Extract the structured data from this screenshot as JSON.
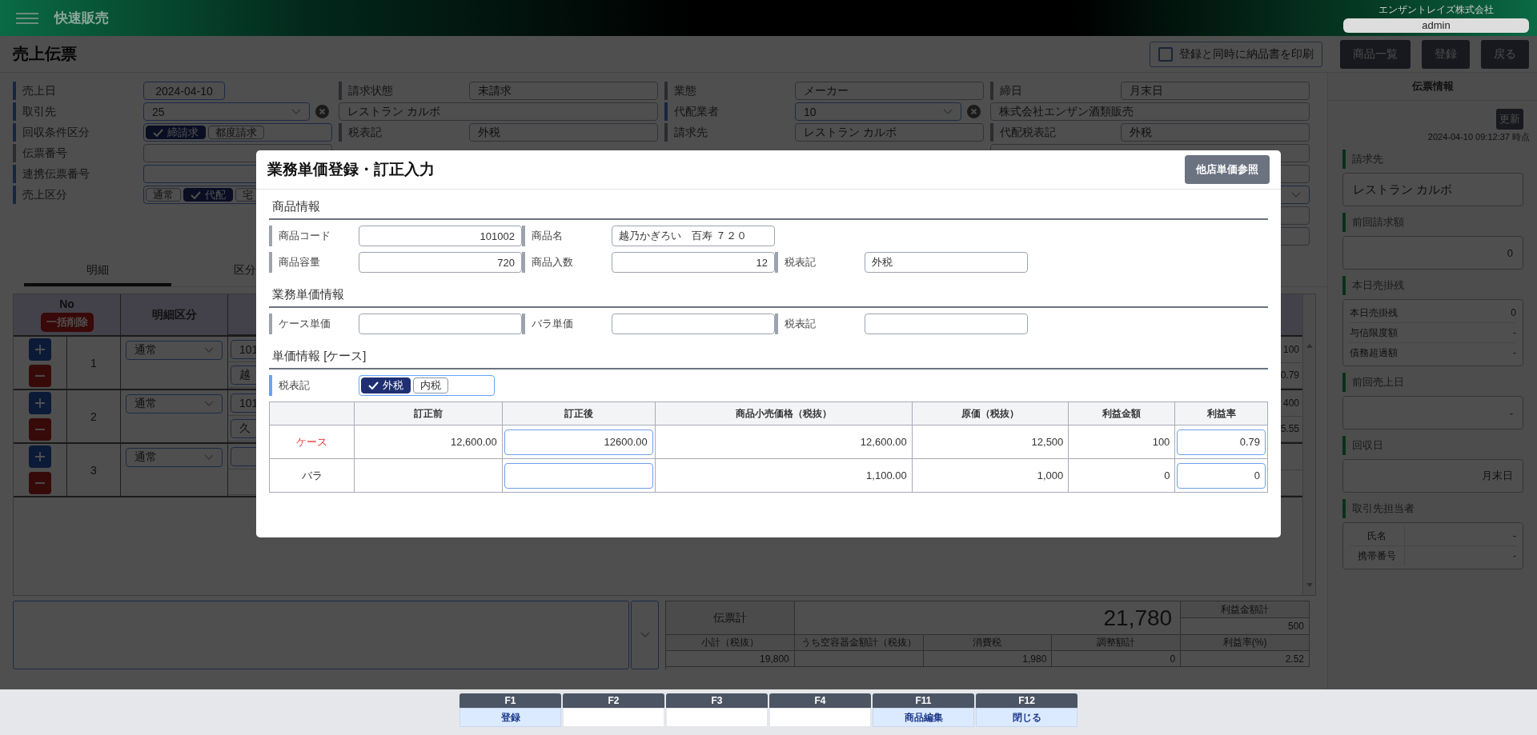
{
  "header": {
    "app_title": "快速販売",
    "company": "エンザントレイズ株式会社",
    "user": "admin"
  },
  "toolbar": {
    "title": "売上伝票",
    "print_option": {
      "label": "登録と同時に納品書を印刷",
      "checked": false
    },
    "buttons": [
      "商品一覧",
      "登録",
      "戻る"
    ]
  },
  "form": {
    "columns": [
      {
        "items": [
          {
            "label": "売上日",
            "kind": "date",
            "editable": true,
            "value": "2024-04-10"
          },
          {
            "label": "取引先",
            "kind": "select_clear",
            "editable": true,
            "value": "25"
          },
          {
            "label": "回収条件区分",
            "kind": "toggle",
            "editable": true,
            "options": [
              {
                "label": "締請求",
                "selected": true
              },
              {
                "label": "都度請求",
                "selected": false
              }
            ]
          },
          {
            "label": "伝票番号",
            "kind": "text",
            "editable": false
          },
          {
            "label": "連携伝票番号",
            "kind": "text",
            "editable": true
          },
          {
            "label": "売上区分",
            "kind": "toggle",
            "editable": true,
            "options": [
              {
                "label": "通常",
                "selected": false
              },
              {
                "label": "代配",
                "selected": true
              },
              {
                "label": "宅",
                "selected": false
              }
            ]
          }
        ]
      },
      {
        "items": [
          {
            "label": "請求状態",
            "kind": "text",
            "editable": false,
            "value": "未請求"
          },
          {
            "kind": "text",
            "editable": false,
            "value": "レストラン カルボ"
          },
          {
            "label": "税表記",
            "kind": "text",
            "editable": false,
            "value": "外税"
          }
        ]
      },
      {
        "items": [
          {
            "label": "業態",
            "kind": "text",
            "editable": false,
            "value": "メーカー"
          },
          {
            "label": "代配業者",
            "kind": "select_clear",
            "editable": true,
            "value": "10"
          },
          {
            "label": "請求先",
            "kind": "text",
            "editable": false,
            "value": "レストラン カルボ"
          }
        ]
      },
      {
        "items": [
          {
            "label": "締日",
            "kind": "text",
            "editable": false,
            "value": "月末日"
          },
          {
            "kind": "text",
            "editable": false,
            "value": "株式会社エンザン酒類販売"
          },
          {
            "label": "代配税表記",
            "kind": "text",
            "editable": false,
            "value": "外税"
          },
          {
            "kind": "text",
            "editable": false
          },
          {
            "kind": "text",
            "editable": false
          },
          {
            "kind": "select",
            "editable": true
          },
          {
            "kind": "text",
            "editable": false
          },
          {
            "kind": "text",
            "editable": false
          }
        ]
      }
    ]
  },
  "tabs": [
    {
      "label": "明細",
      "selected": true
    },
    {
      "label": "区分",
      "selected": false
    }
  ],
  "lines": {
    "columns": [
      "No",
      "明細区分"
    ],
    "bulk_delete": "一括削除",
    "rows": [
      {
        "no": "1",
        "type": "通常",
        "code": "101",
        "name": "越",
        "amount": "100",
        "rate": "0.79"
      },
      {
        "no": "2",
        "type": "通常",
        "code": "101",
        "name": "久",
        "amount": "400",
        "rate": "5.55"
      },
      {
        "no": "3",
        "type": "通常"
      }
    ]
  },
  "totals": {
    "total_label": "伝票計",
    "total": "21,780",
    "profit_label": "利益金額計",
    "profit": "500",
    "columns": [
      {
        "label": "小計（税抜）",
        "value": "19,800"
      },
      {
        "label": "うち空容器金額計（税抜）"
      },
      {
        "label": "消費税",
        "value": "1,980"
      },
      {
        "label": "調整額計",
        "value": "0"
      },
      {
        "label": "利益率(%)",
        "value": "2.52"
      }
    ]
  },
  "sidebar": {
    "title": "伝票情報",
    "refresh_button": "更新",
    "timestamp": "2024-04-10 09:12:37 時点",
    "sections": [
      {
        "title": "請求先",
        "kind": "text",
        "value": "レストラン カルボ"
      },
      {
        "title": "前回請求額",
        "kind": "amount",
        "value": "0"
      },
      {
        "title": "本日売掛残",
        "kind": "list",
        "rows": [
          {
            "label": "本日売掛残",
            "value": "0"
          },
          {
            "label": "与信限度額",
            "value": "-"
          },
          {
            "label": "債務超過額",
            "value": "-"
          }
        ]
      },
      {
        "title": "前回売上日",
        "kind": "amount",
        "value": "-"
      },
      {
        "title": "回収日",
        "kind": "amount",
        "value": "月末日"
      },
      {
        "title": "取引先担当者",
        "kind": "table",
        "rows": [
          {
            "label": "氏名",
            "value": "-"
          },
          {
            "label": "携帯番号",
            "value": "-"
          }
        ]
      }
    ]
  },
  "dialog": {
    "title": "業務単価登録・訂正入力",
    "reference_button": "他店単価参照",
    "sections": [
      {
        "title": "商品情報",
        "rows": [
          [
            {
              "label": "商品コード",
              "kind": "number",
              "value": "101002"
            },
            {
              "label": "商品名",
              "kind": "text",
              "value": "越乃かぎろい　百寿 ７２０"
            }
          ],
          [
            {
              "label": "商品容量",
              "kind": "number",
              "value": "720"
            },
            {
              "label": "商品入数",
              "kind": "number",
              "value": "12"
            },
            {
              "label": "税表記",
              "kind": "text",
              "value": "外税"
            }
          ]
        ]
      },
      {
        "title": "業務単価情報",
        "rows": [
          [
            {
              "label": "ケース単価",
              "kind": "number"
            },
            {
              "label": "バラ単価",
              "kind": "number"
            },
            {
              "label": "税表記",
              "kind": "text"
            }
          ]
        ]
      },
      {
        "title": "単価情報 [ケース]",
        "toggle": {
          "label": "税表記",
          "options": [
            {
              "label": "外税",
              "selected": true
            },
            {
              "label": "内税",
              "selected": false
            }
          ]
        },
        "price_table": {
          "columns": [
            "訂正前",
            "訂正後",
            "商品小売価格（税抜）",
            "原価（税抜）",
            "利益金額",
            "利益率"
          ],
          "rows": [
            {
              "label": "ケース",
              "highlighted": true,
              "before": "12,600.00",
              "after": "12600.00",
              "retail": "12,600.00",
              "cost": "12,500",
              "profit": "100",
              "rate": "0.79"
            },
            {
              "label": "バラ",
              "highlighted": false,
              "retail": "1,100.00",
              "cost": "1,000",
              "profit": "0",
              "rate": "0"
            }
          ]
        }
      }
    ]
  },
  "function_keys": [
    {
      "key": "F1",
      "label": "登録"
    },
    {
      "key": "F2"
    },
    {
      "key": "F3"
    },
    {
      "key": "F4"
    },
    {
      "key": "F11",
      "label": "商品編集"
    },
    {
      "key": "F12",
      "label": "閉じる"
    }
  ]
}
